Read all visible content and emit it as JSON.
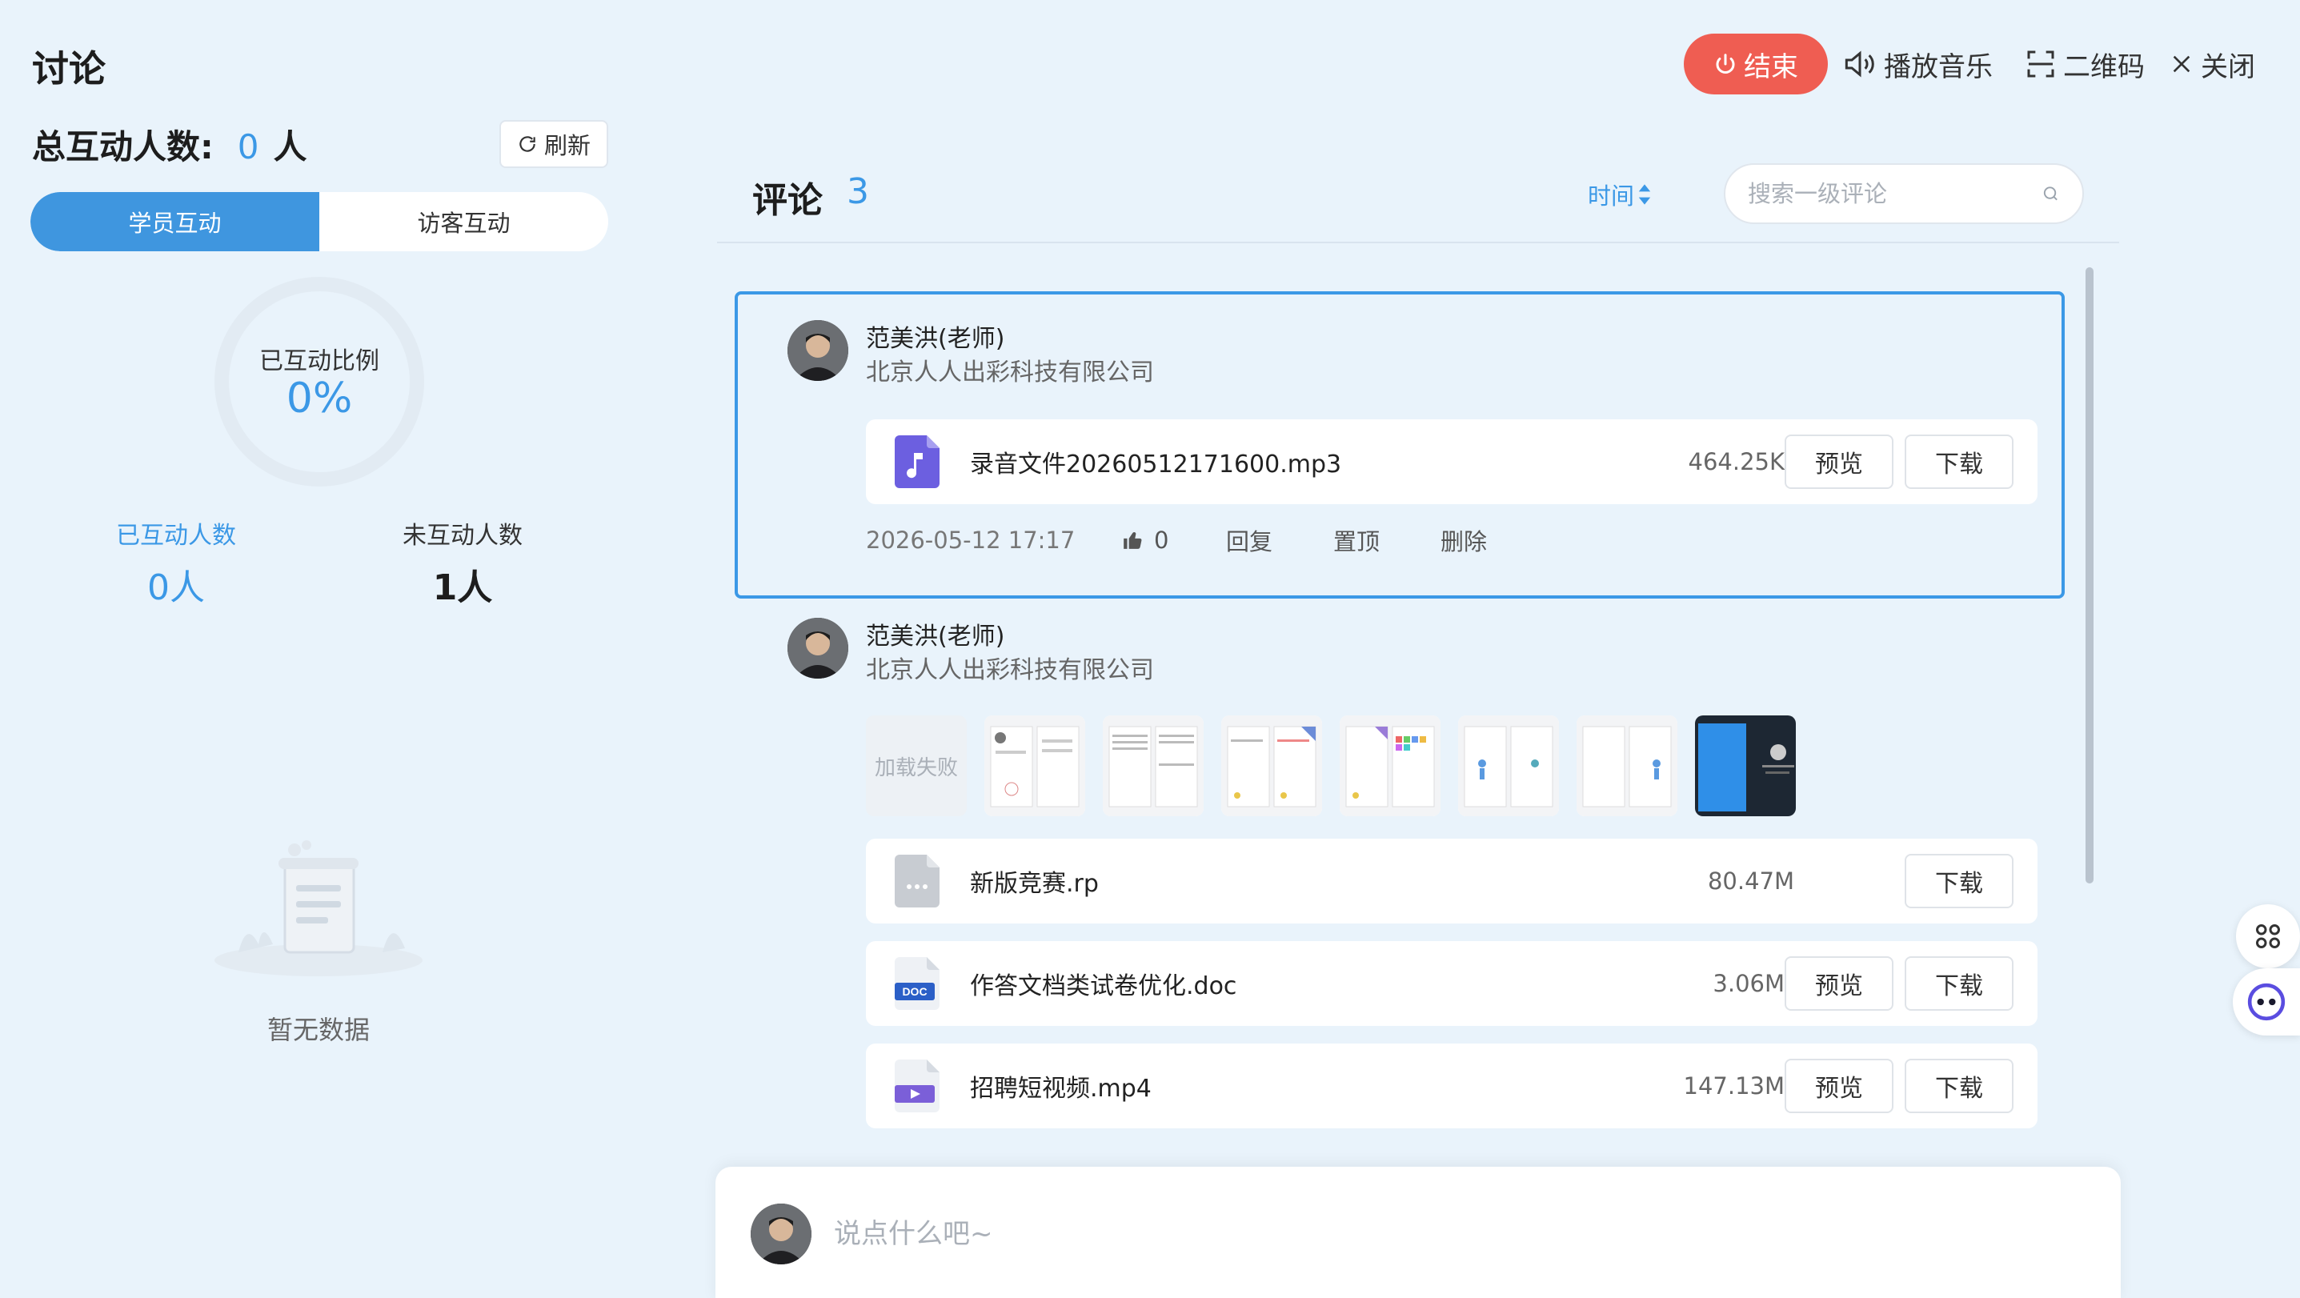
{
  "left": {
    "title": "讨论",
    "total_label": "总互动人数:",
    "total_value": "0",
    "total_unit": "人",
    "refresh_label": "刷新",
    "tabs": [
      {
        "label": "学员互动",
        "active": true
      },
      {
        "label": "访客互动",
        "active": false
      }
    ],
    "ratio_label": "已互动比例",
    "ratio_value": "0%",
    "ratio_fraction": 0,
    "interacted_label": "已互动人数",
    "interacted_value": "0人",
    "not_interacted_label": "未互动人数",
    "not_interacted_value": "1人",
    "empty_text": "暂无数据"
  },
  "toolbar": {
    "end_label": "结束",
    "music_label": "播放音乐",
    "qr_label": "二维码",
    "close_label": "关闭",
    "end_color": "#ef5d52"
  },
  "comments": {
    "title": "评论",
    "count": "3",
    "sort_label": "时间",
    "search_placeholder": "搜索一级评论",
    "items": [
      {
        "name": "范美洪(老师)",
        "org": "北京人人出彩科技有限公司",
        "files": [
          {
            "icon": "music-file-icon",
            "name": "录音文件20260512171600.mp3",
            "size": "464.25K",
            "preview": "预览",
            "download": "下载"
          }
        ],
        "time": "2026-05-12 17:17",
        "likes": "0",
        "reply": "回复",
        "pin": "置顶",
        "delete": "删除"
      },
      {
        "name": "范美洪(老师)",
        "org": "北京人人出彩科技有限公司",
        "failed_label": "加载失败",
        "files": [
          {
            "icon": "generic-file-icon",
            "name": "新版竞赛.rp",
            "size": "80.47M",
            "download": "下载"
          },
          {
            "icon": "doc-file-icon",
            "name": "作答文档类试卷优化.doc",
            "size": "3.06M",
            "preview": "预览",
            "download": "下载"
          },
          {
            "icon": "video-file-icon",
            "name": "招聘短视频.mp4",
            "size": "147.13M",
            "preview": "预览",
            "download": "下载"
          }
        ]
      }
    ]
  },
  "composer": {
    "placeholder": "说点什么吧~"
  },
  "colors": {
    "accent": "#3b98e6",
    "background": "#e9f3fb"
  }
}
